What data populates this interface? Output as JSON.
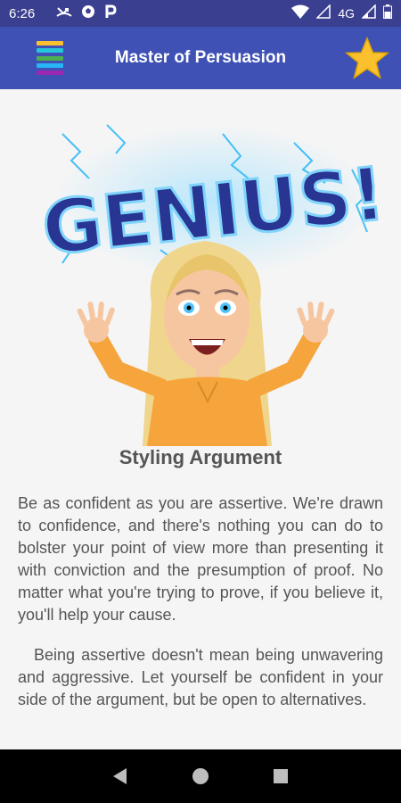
{
  "status_bar": {
    "time": "6:26",
    "network": "4G",
    "icons": [
      "missed-call-icon",
      "soccer-ball-icon",
      "parking-icon",
      "wifi-icon",
      "signal-icon",
      "battery-icon"
    ]
  },
  "app_bar": {
    "title": "Master of Persuasion",
    "menu_icon": "menu-icon",
    "favorite_icon": "star-icon",
    "colors": {
      "background": "#3f51b5",
      "star": "#fbc02d"
    }
  },
  "illustration": {
    "text": "GENIUS!"
  },
  "article": {
    "heading": "Styling Argument",
    "paragraphs": [
      "Be as confident as you are assertive. We're drawn to confidence, and there's nothing you can do to bolster your point of view more than presenting it with conviction and the presumption of proof. No matter what you're trying to prove, if you believe it, you'll help your cause.",
      "Being assertive doesn't mean being unwavering and aggressive. Let yourself be confident in your side of the argument, but be open to alternatives."
    ]
  },
  "nav_bar": {
    "buttons": [
      "back-icon",
      "home-icon",
      "recents-icon"
    ]
  }
}
